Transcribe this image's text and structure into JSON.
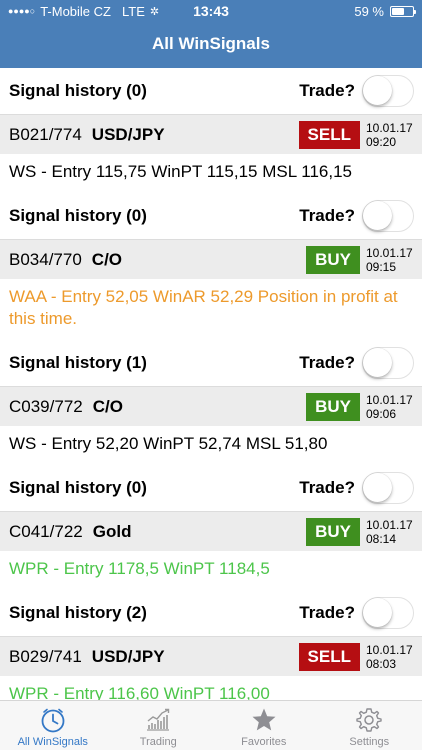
{
  "status": {
    "carrier": "T-Mobile CZ",
    "network": "LTE",
    "time": "13:43",
    "battery": "59 %",
    "battery_level": 0.59
  },
  "header": {
    "title": "All WinSignals"
  },
  "labels": {
    "trade": "Trade?"
  },
  "colors": {
    "sell": "#b50e12",
    "buy": "#3f8f1f",
    "waa_text": "#ed9a2c",
    "wpr_text": "#4cc54a"
  },
  "signals": [
    {
      "history": "Signal history (0)",
      "trade_on": false,
      "code": "B021/774",
      "instrument": "USD/JPY",
      "action": "SELL",
      "date": "10.01.17",
      "time": "09:20",
      "text": "WS - Entry 115,75 WinPT 115,15 MSL 116,15",
      "text_color": "#000000"
    },
    {
      "history": "Signal history (0)",
      "trade_on": false,
      "code": "B034/770",
      "instrument": "C/O",
      "action": "BUY",
      "date": "10.01.17",
      "time": "09:15",
      "text": "WAA - Entry 52,05 WinAR 52,29 Position in profit at this time.",
      "text_color": "#ed9a2c"
    },
    {
      "history": "Signal history (1)",
      "trade_on": false,
      "code": "C039/772",
      "instrument": "C/O",
      "action": "BUY",
      "date": "10.01.17",
      "time": "09:06",
      "text": "WS - Entry 52,20 WinPT 52,74 MSL 51,80",
      "text_color": "#000000"
    },
    {
      "history": "Signal history (0)",
      "trade_on": false,
      "code": "C041/722",
      "instrument": "Gold",
      "action": "BUY",
      "date": "10.01.17",
      "time": "08:14",
      "text": "WPR - Entry 1178,5 WinPT 1184,5",
      "text_color": "#4cc54a"
    },
    {
      "history": "Signal history (2)",
      "trade_on": false,
      "code": "B029/741",
      "instrument": "USD/JPY",
      "action": "SELL",
      "date": "10.01.17",
      "time": "08:03",
      "text": "WPR - Entry 116,60 WinPT 116,00",
      "text_color": "#4cc54a"
    }
  ],
  "tabs": [
    {
      "label": "All WinSignals",
      "icon": "clock-icon",
      "active": true
    },
    {
      "label": "Trading",
      "icon": "trading-chart-icon",
      "active": false
    },
    {
      "label": "Favorites",
      "icon": "star-icon",
      "active": false
    },
    {
      "label": "Settings",
      "icon": "gear-icon",
      "active": false
    }
  ]
}
